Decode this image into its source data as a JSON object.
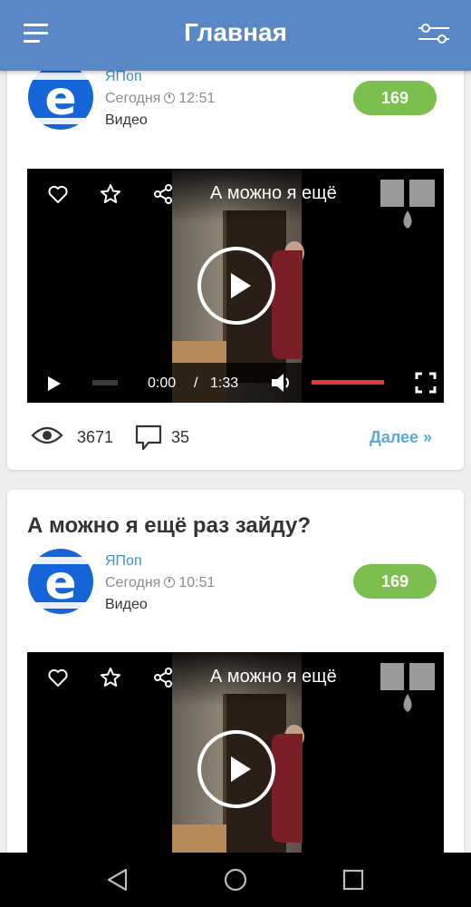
{
  "header": {
    "title": "Главная",
    "menu_icon": "hamburger-menu-icon",
    "settings_icon": "sliders-settings-icon",
    "color": "#5a87c8"
  },
  "posts": [
    {
      "title": "",
      "author": "ЯПоп",
      "date": "Сегодня",
      "time": "12:51",
      "category": "Видео",
      "score": "169",
      "video": {
        "title": "А можно я ещё",
        "current_time": "0:00",
        "separator": "/",
        "duration": "1:33",
        "progress_fraction": 0.0
      },
      "views": "3671",
      "comments": "35",
      "more_label": "Далее »"
    },
    {
      "title": "А можно я ещё раз зайду?",
      "author": "ЯПоп",
      "date": "Сегодня",
      "time": "10:51",
      "category": "Видео",
      "score": "169",
      "video": {
        "title": "А можно я ещё"
      }
    }
  ],
  "colors": {
    "score_badge": "#7bbf4e",
    "author_link": "#3d8fc5",
    "more_link": "#5aa8dd",
    "volume": "#e53935"
  },
  "navbar": {
    "icons": [
      "back-triangle-icon",
      "home-circle-icon",
      "recents-square-icon"
    ]
  }
}
